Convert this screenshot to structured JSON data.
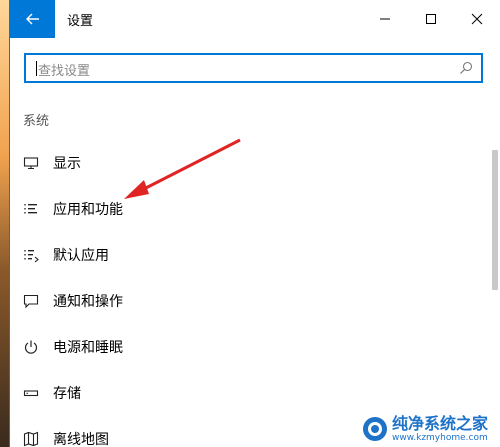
{
  "window": {
    "title": "设置"
  },
  "search": {
    "placeholder": "查找设置"
  },
  "section": {
    "title": "系统"
  },
  "nav": {
    "items": [
      {
        "label": "显示",
        "icon": "monitor-icon"
      },
      {
        "label": "应用和功能",
        "icon": "list-icon"
      },
      {
        "label": "默认应用",
        "icon": "default-apps-icon"
      },
      {
        "label": "通知和操作",
        "icon": "notification-icon"
      },
      {
        "label": "电源和睡眠",
        "icon": "power-icon"
      },
      {
        "label": "存储",
        "icon": "storage-icon"
      },
      {
        "label": "离线地图",
        "icon": "map-icon"
      }
    ]
  },
  "colors": {
    "accent": "#0078d7",
    "annotation": "#e02424"
  },
  "watermark": {
    "title": "纯净系统之家",
    "url": "www.kzmyhome.com"
  }
}
